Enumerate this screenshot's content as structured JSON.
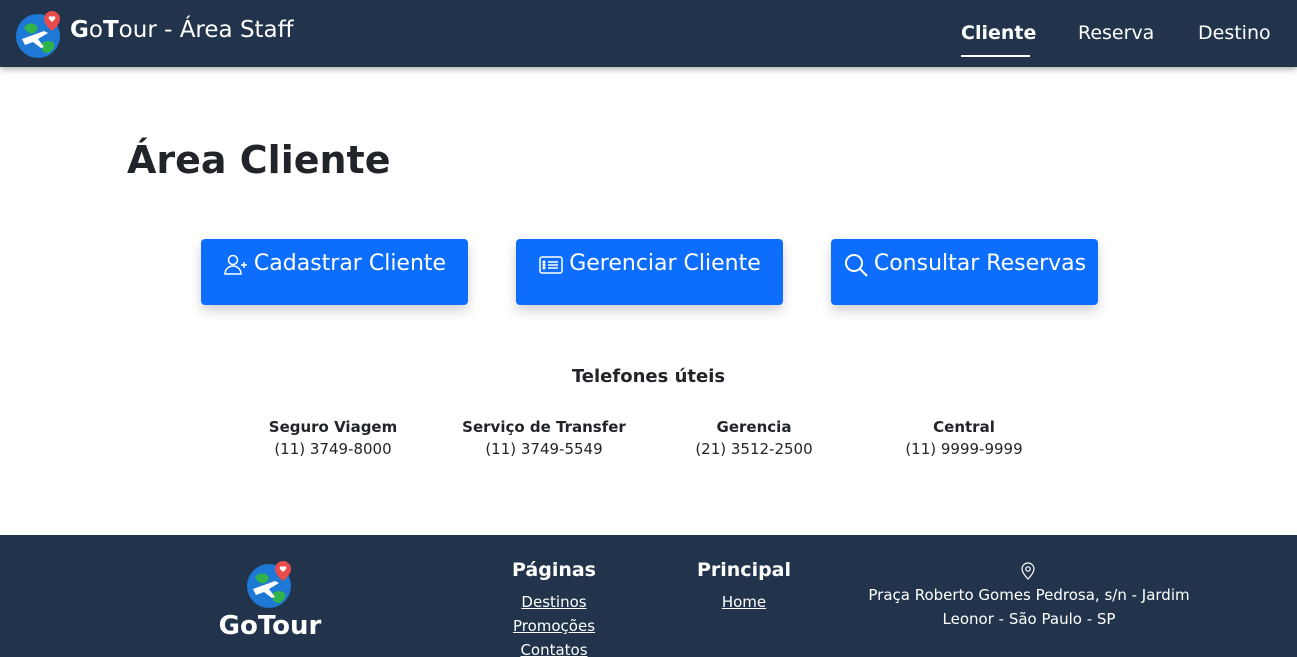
{
  "brand": {
    "bold_g": "G",
    "mid_o": "o",
    "bold_t": "T",
    "rest": "our - Área Staff",
    "logo_icon": "globe-airplane-heart-icon"
  },
  "nav": {
    "items": [
      {
        "label": "Cliente",
        "active": true
      },
      {
        "label": "Reserva",
        "active": false
      },
      {
        "label": "Destino",
        "active": false
      }
    ]
  },
  "main": {
    "title": "Área Cliente",
    "actions": [
      {
        "label": "Cadastrar Cliente",
        "icon": "person-plus-icon"
      },
      {
        "label": "Gerenciar Cliente",
        "icon": "card-list-icon"
      },
      {
        "label": "Consultar Reservas",
        "icon": "search-icon"
      }
    ],
    "button_color": "#0d6efd"
  },
  "phones": {
    "title": "Telefones úteis",
    "items": [
      {
        "label": "Seguro Viagem",
        "number": "(11) 3749-8000"
      },
      {
        "label": "Serviço de Transfer",
        "number": "(11) 3749-5549"
      },
      {
        "label": "Gerencia",
        "number": "(21) 3512-2500"
      },
      {
        "label": "Central",
        "number": "(11) 9999-9999"
      }
    ]
  },
  "footer": {
    "brand": "GoTour",
    "pages": {
      "title": "Páginas",
      "links": [
        "Destinos",
        "Promoções",
        "Contatos"
      ]
    },
    "main": {
      "title": "Principal",
      "links": [
        "Home"
      ]
    },
    "address": "Praça Roberto Gomes Pedrosa, s/n - Jardim Leonor - São Paulo - SP",
    "address_icon": "map-pin-icon",
    "background": "#22344b"
  }
}
